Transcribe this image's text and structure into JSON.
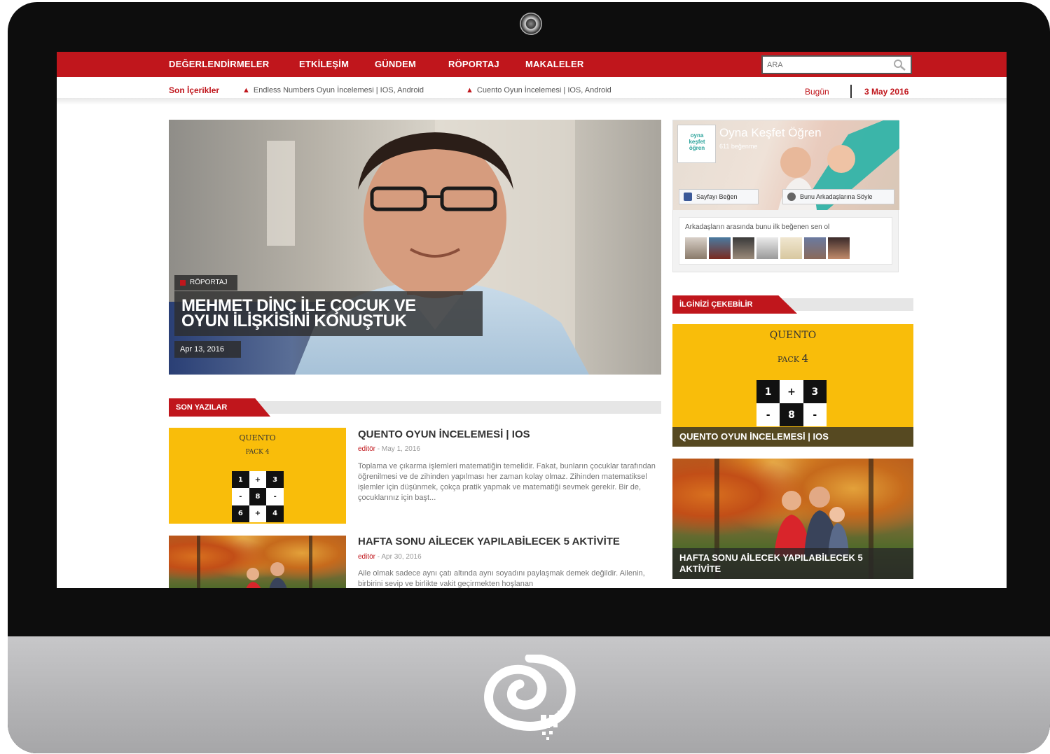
{
  "nav": {
    "items": [
      "DEĞERLENDİRMELER",
      "ETKİLEŞİM",
      "GÜNDEM",
      "RÖPORTAJ",
      "MAKALELER"
    ],
    "search_placeholder": "ARA"
  },
  "ticker": {
    "label": "Son İçerikler",
    "items": [
      "Endless Numbers Oyun İncelemesi | IOS, Android",
      "Cuento Oyun İncelemesi | IOS, Android"
    ],
    "today_label": "Bugün",
    "date": "3 May 2016"
  },
  "hero": {
    "category": "RÖPORTAJ",
    "title_line1": "MEHMET DİNÇ İLE ÇOCUK VE",
    "title_line2": "OYUN İLİŞKİSİNİ KONUŞTUK",
    "date": "Apr 13, 2016"
  },
  "latest": {
    "heading": "SON YAZILAR",
    "posts": [
      {
        "title": "QUENTO OYUN İNCELEMESİ | IOS",
        "author": "editör",
        "date": "May 1, 2016",
        "excerpt": "Toplama ve çıkarma işlemleri matematiğin temelidir. Fakat, bunların çocuklar tarafından öğrenilmesi ve de zihinden yapılması her zaman kolay olmaz. Zihinden matematiksel işlemler için düşünmek, çokça pratik yapmak ve matematiği sevmek gerekir. Bir de, çocuklarınız için başt..."
      },
      {
        "title": "HAFTA SONU AİLECEK YAPILABİLECEK 5 AKTİVİTE",
        "author": "editör",
        "date": "Apr 30, 2016",
        "excerpt": "Aile olmak sadece aynı çatı altında aynı soyadını paylaşmak demek değildir. Ailenin, birbirini sevip ve birlikte vakit geçirmekten hoşlanan"
      }
    ]
  },
  "facebook": {
    "page_name": "Oyna Keşfet Öğren",
    "likes": "611 beğenme",
    "like_button": "Sayfayı Beğen",
    "share_button": "Bunu Arkadaşlarına Söyle",
    "friends_text": "Arkadaşların arasında bunu ilk beğenen sen ol",
    "logo_text": "oyna keşfet öğren"
  },
  "featured": {
    "heading": "İLGİNİZİ ÇEKEBİLİR",
    "cards": [
      {
        "title": "QUENTO OYUN İNCELEMESİ | IOS"
      },
      {
        "title": "HAFTA SONU AİLECEK YAPILABİLECEK 5 AKTİVİTE"
      }
    ]
  },
  "quento": {
    "brand": "QUENTO",
    "pack": "PACK",
    "pack_number": "4",
    "big_grid": [
      "1",
      "+",
      "3",
      "-",
      "8",
      "-"
    ],
    "small_grid": [
      "1",
      "+",
      "3",
      "-",
      "8",
      "-",
      "6",
      "+",
      "4"
    ]
  },
  "colors": {
    "brand_red": "#c0161c",
    "quento_yellow": "#f9bd0a",
    "text_dark": "#333333"
  }
}
